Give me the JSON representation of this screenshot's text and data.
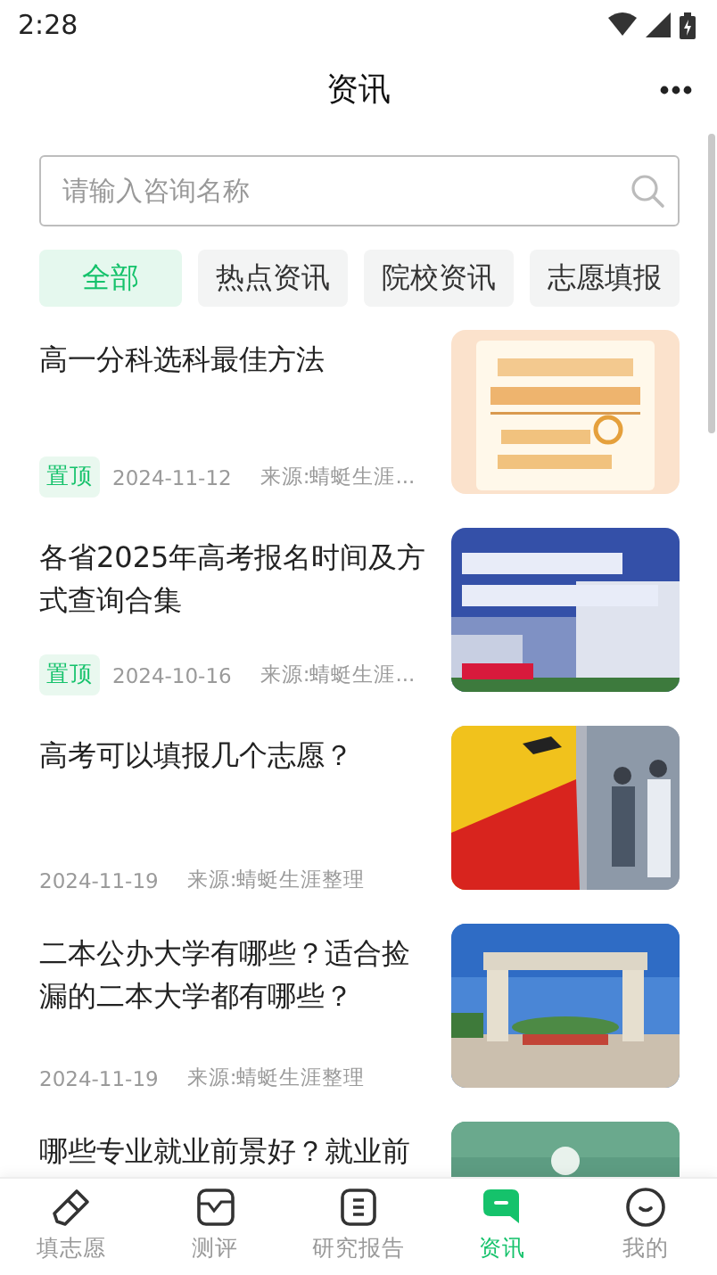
{
  "status_bar": {
    "time": "2:28"
  },
  "header": {
    "title": "资讯"
  },
  "search": {
    "placeholder": "请输入咨询名称"
  },
  "tabs": [
    {
      "label": "全部",
      "selected": true
    },
    {
      "label": "热点资讯",
      "selected": false
    },
    {
      "label": "院校资讯",
      "selected": false
    },
    {
      "label": "志愿填报",
      "selected": false
    }
  ],
  "articles": [
    {
      "title": "高一分科选科最佳方法",
      "tag": "置顶",
      "date": "2024-11-12",
      "source": "来源:蜻蜓生涯..."
    },
    {
      "title": "各省2025年高考报名时间及方式查询合集",
      "tag": "置顶",
      "date": "2024-10-16",
      "source": "来源:蜻蜓生涯..."
    },
    {
      "title": "高考可以填报几个志愿？",
      "date": "2024-11-19",
      "source": "来源:蜻蜓生涯整理"
    },
    {
      "title": "二本公办大学有哪些？适合捡漏的二本大学都有哪些？",
      "date": "2024-11-19",
      "source": "来源:蜻蜓生涯整理"
    },
    {
      "title": "哪些专业就业前景好？就业前"
    }
  ],
  "bottom_nav": [
    {
      "label": "填志愿",
      "selected": false
    },
    {
      "label": "测评",
      "selected": false
    },
    {
      "label": "研究报告",
      "selected": false
    },
    {
      "label": "资讯",
      "selected": true
    },
    {
      "label": "我的",
      "selected": false
    }
  ]
}
